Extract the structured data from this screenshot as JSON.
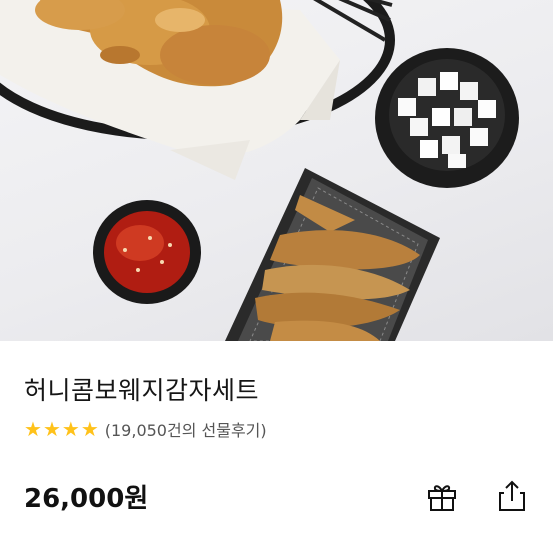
{
  "product": {
    "name": "허니콤보웨지감자세트",
    "rating_stars": 4,
    "review_text": "(19,050건의 선물후기)",
    "price": "26,000원"
  },
  "colors": {
    "star": "#ffc21a",
    "text": "#161616",
    "muted": "#555555"
  },
  "icons": {
    "gift": "gift-icon",
    "share": "share-icon"
  }
}
